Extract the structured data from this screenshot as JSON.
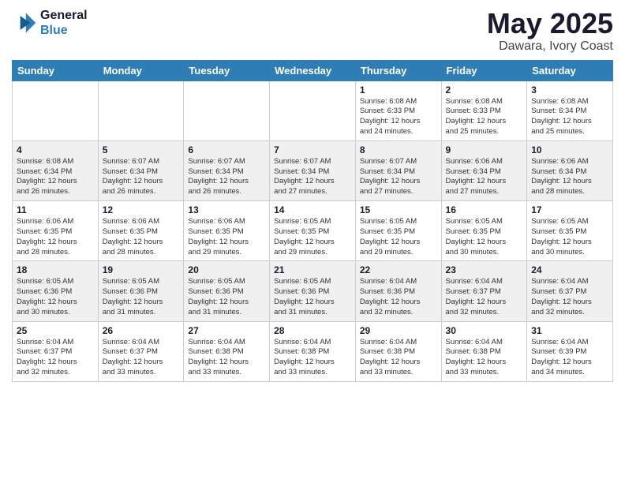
{
  "header": {
    "logo_line1": "General",
    "logo_line2": "Blue",
    "month": "May 2025",
    "location": "Dawara, Ivory Coast"
  },
  "days_of_week": [
    "Sunday",
    "Monday",
    "Tuesday",
    "Wednesday",
    "Thursday",
    "Friday",
    "Saturday"
  ],
  "weeks": [
    [
      {
        "day": "",
        "info": ""
      },
      {
        "day": "",
        "info": ""
      },
      {
        "day": "",
        "info": ""
      },
      {
        "day": "",
        "info": ""
      },
      {
        "day": "1",
        "info": "Sunrise: 6:08 AM\nSunset: 6:33 PM\nDaylight: 12 hours\nand 24 minutes."
      },
      {
        "day": "2",
        "info": "Sunrise: 6:08 AM\nSunset: 6:33 PM\nDaylight: 12 hours\nand 25 minutes."
      },
      {
        "day": "3",
        "info": "Sunrise: 6:08 AM\nSunset: 6:34 PM\nDaylight: 12 hours\nand 25 minutes."
      }
    ],
    [
      {
        "day": "4",
        "info": "Sunrise: 6:08 AM\nSunset: 6:34 PM\nDaylight: 12 hours\nand 26 minutes."
      },
      {
        "day": "5",
        "info": "Sunrise: 6:07 AM\nSunset: 6:34 PM\nDaylight: 12 hours\nand 26 minutes."
      },
      {
        "day": "6",
        "info": "Sunrise: 6:07 AM\nSunset: 6:34 PM\nDaylight: 12 hours\nand 26 minutes."
      },
      {
        "day": "7",
        "info": "Sunrise: 6:07 AM\nSunset: 6:34 PM\nDaylight: 12 hours\nand 27 minutes."
      },
      {
        "day": "8",
        "info": "Sunrise: 6:07 AM\nSunset: 6:34 PM\nDaylight: 12 hours\nand 27 minutes."
      },
      {
        "day": "9",
        "info": "Sunrise: 6:06 AM\nSunset: 6:34 PM\nDaylight: 12 hours\nand 27 minutes."
      },
      {
        "day": "10",
        "info": "Sunrise: 6:06 AM\nSunset: 6:34 PM\nDaylight: 12 hours\nand 28 minutes."
      }
    ],
    [
      {
        "day": "11",
        "info": "Sunrise: 6:06 AM\nSunset: 6:35 PM\nDaylight: 12 hours\nand 28 minutes."
      },
      {
        "day": "12",
        "info": "Sunrise: 6:06 AM\nSunset: 6:35 PM\nDaylight: 12 hours\nand 28 minutes."
      },
      {
        "day": "13",
        "info": "Sunrise: 6:06 AM\nSunset: 6:35 PM\nDaylight: 12 hours\nand 29 minutes."
      },
      {
        "day": "14",
        "info": "Sunrise: 6:05 AM\nSunset: 6:35 PM\nDaylight: 12 hours\nand 29 minutes."
      },
      {
        "day": "15",
        "info": "Sunrise: 6:05 AM\nSunset: 6:35 PM\nDaylight: 12 hours\nand 29 minutes."
      },
      {
        "day": "16",
        "info": "Sunrise: 6:05 AM\nSunset: 6:35 PM\nDaylight: 12 hours\nand 30 minutes."
      },
      {
        "day": "17",
        "info": "Sunrise: 6:05 AM\nSunset: 6:35 PM\nDaylight: 12 hours\nand 30 minutes."
      }
    ],
    [
      {
        "day": "18",
        "info": "Sunrise: 6:05 AM\nSunset: 6:36 PM\nDaylight: 12 hours\nand 30 minutes."
      },
      {
        "day": "19",
        "info": "Sunrise: 6:05 AM\nSunset: 6:36 PM\nDaylight: 12 hours\nand 31 minutes."
      },
      {
        "day": "20",
        "info": "Sunrise: 6:05 AM\nSunset: 6:36 PM\nDaylight: 12 hours\nand 31 minutes."
      },
      {
        "day": "21",
        "info": "Sunrise: 6:05 AM\nSunset: 6:36 PM\nDaylight: 12 hours\nand 31 minutes."
      },
      {
        "day": "22",
        "info": "Sunrise: 6:04 AM\nSunset: 6:36 PM\nDaylight: 12 hours\nand 32 minutes."
      },
      {
        "day": "23",
        "info": "Sunrise: 6:04 AM\nSunset: 6:37 PM\nDaylight: 12 hours\nand 32 minutes."
      },
      {
        "day": "24",
        "info": "Sunrise: 6:04 AM\nSunset: 6:37 PM\nDaylight: 12 hours\nand 32 minutes."
      }
    ],
    [
      {
        "day": "25",
        "info": "Sunrise: 6:04 AM\nSunset: 6:37 PM\nDaylight: 12 hours\nand 32 minutes."
      },
      {
        "day": "26",
        "info": "Sunrise: 6:04 AM\nSunset: 6:37 PM\nDaylight: 12 hours\nand 33 minutes."
      },
      {
        "day": "27",
        "info": "Sunrise: 6:04 AM\nSunset: 6:38 PM\nDaylight: 12 hours\nand 33 minutes."
      },
      {
        "day": "28",
        "info": "Sunrise: 6:04 AM\nSunset: 6:38 PM\nDaylight: 12 hours\nand 33 minutes."
      },
      {
        "day": "29",
        "info": "Sunrise: 6:04 AM\nSunset: 6:38 PM\nDaylight: 12 hours\nand 33 minutes."
      },
      {
        "day": "30",
        "info": "Sunrise: 6:04 AM\nSunset: 6:38 PM\nDaylight: 12 hours\nand 33 minutes."
      },
      {
        "day": "31",
        "info": "Sunrise: 6:04 AM\nSunset: 6:39 PM\nDaylight: 12 hours\nand 34 minutes."
      }
    ]
  ]
}
